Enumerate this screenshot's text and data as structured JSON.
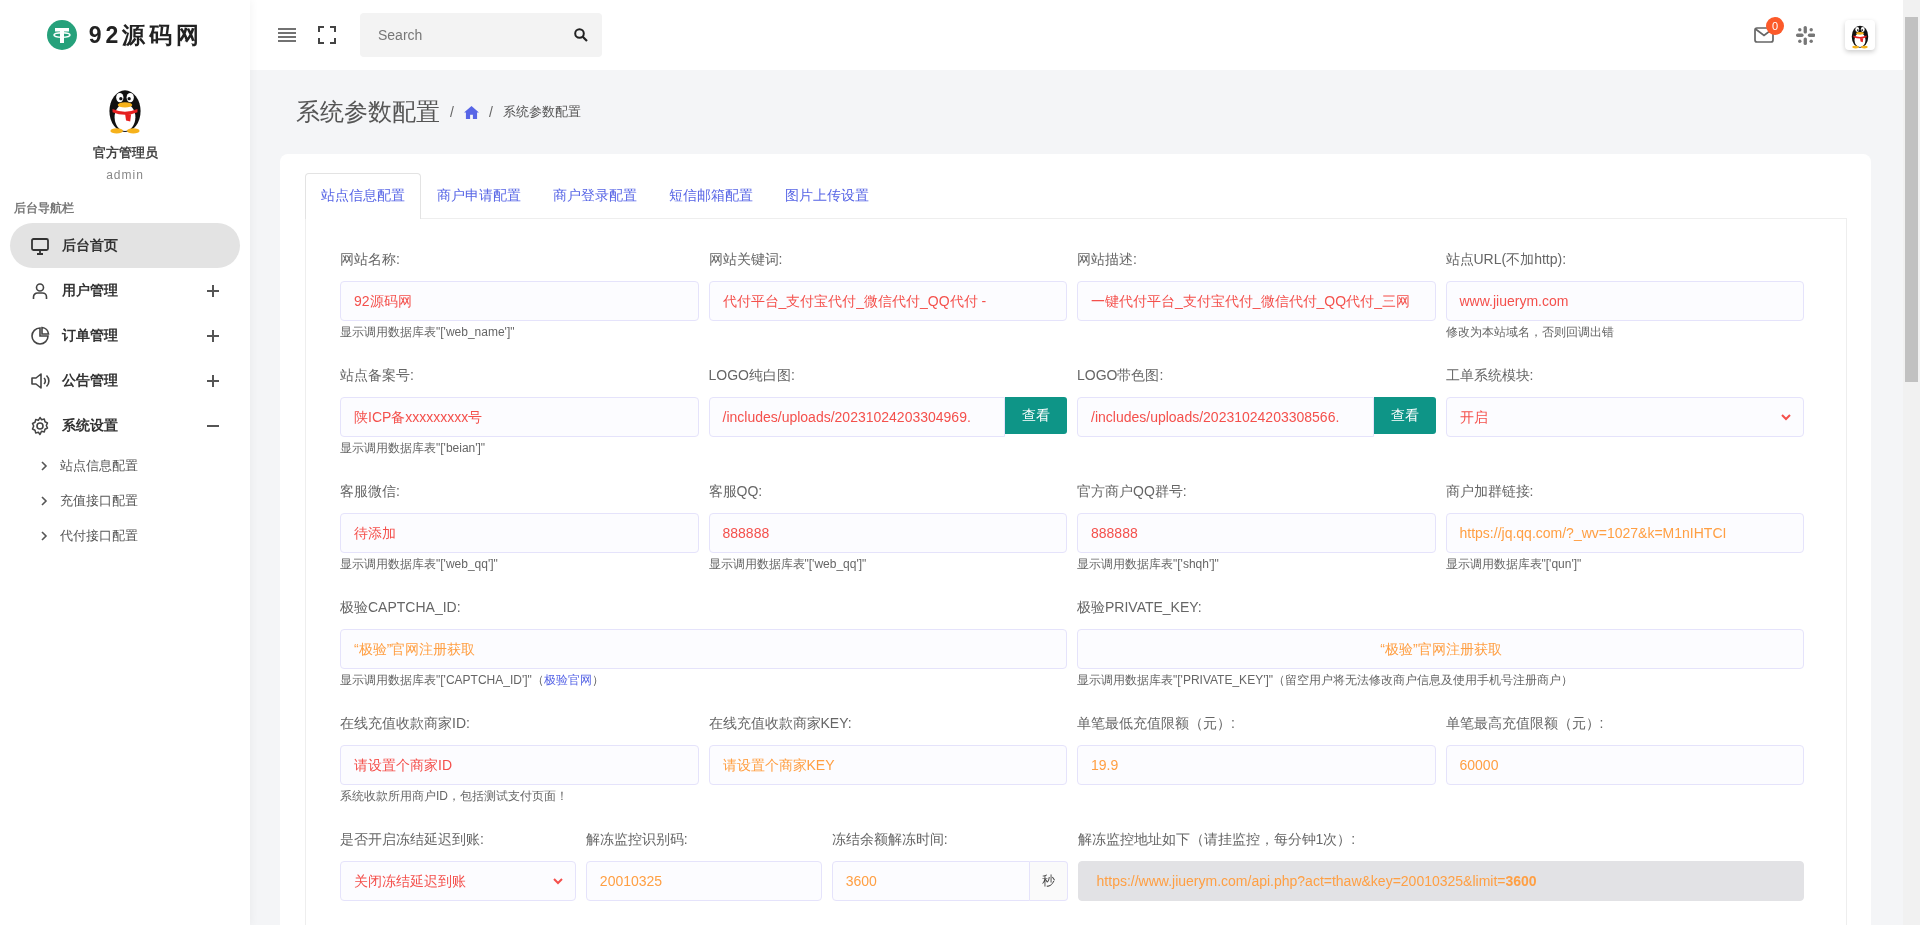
{
  "sidebar": {
    "brand": "92源码网",
    "user_name": "官方管理员",
    "user_role": "admin",
    "section_title": "后台导航栏",
    "nav": [
      {
        "label": "后台首页",
        "selected": true
      },
      {
        "label": "用户管理",
        "selected": false,
        "expanded": false
      },
      {
        "label": "订单管理",
        "selected": false,
        "expanded": false
      },
      {
        "label": "公告管理",
        "selected": false,
        "expanded": false
      },
      {
        "label": "系统设置",
        "selected": false,
        "expanded": true,
        "children": [
          {
            "label": "站点信息配置"
          },
          {
            "label": "充值接口配置"
          },
          {
            "label": "代付接口配置"
          }
        ]
      }
    ]
  },
  "header": {
    "search": {
      "placeholder": "Search"
    },
    "mail_badge": "0"
  },
  "page": {
    "title": "系统参数配置",
    "breadcrumb": [
      {
        "kind": "separator",
        "text": "/"
      },
      {
        "kind": "home"
      },
      {
        "kind": "separator",
        "text": "/"
      },
      {
        "kind": "current",
        "text": "系统参数配置"
      }
    ]
  },
  "tabs": [
    {
      "label": "站点信息配置",
      "selected": true
    },
    {
      "label": "商户申请配置",
      "selected": false
    },
    {
      "label": "商户登录配置",
      "selected": false
    },
    {
      "label": "短信邮箱配置",
      "selected": false
    },
    {
      "label": "图片上传设置",
      "selected": false
    }
  ],
  "form": {
    "rows": [
      {
        "kind": "quarters",
        "fields": [
          {
            "kind": "text",
            "label": "网站名称:",
            "value": "92源码网",
            "color": "#f4504c",
            "hint": "显示调用数据库表\"['web_name']\""
          },
          {
            "kind": "text",
            "label": "网站关键词:",
            "value": "代付平台_支付宝代付_微信代付_QQ代付 -",
            "color": "#f4504c"
          },
          {
            "kind": "text",
            "label": "网站描述:",
            "value": "一键代付平台_支付宝代付_微信代付_QQ代付_三网",
            "color": "#f4504c"
          },
          {
            "kind": "text",
            "label": "站点URL(不加http):",
            "value": "www.jiuerym.com",
            "color": "#f4504c",
            "hint": "修改为本站域名，否则回调出错"
          }
        ]
      },
      {
        "kind": "quarters",
        "fields": [
          {
            "kind": "text",
            "label": "站点备案号:",
            "value": "陕ICP备xxxxxxxxx号",
            "color": "#f4504c",
            "hint": "显示调用数据库表\"['beian']\""
          },
          {
            "kind": "button",
            "label": "LOGO纯白图:",
            "value": "/includes/uploads/20231024203304969.",
            "color": "#f4504c",
            "button": "查看"
          },
          {
            "kind": "button",
            "label": "LOGO带色图:",
            "value": "/includes/uploads/20231024203308566.",
            "color": "#f4504c",
            "button": "查看"
          },
          {
            "kind": "select",
            "label": "工单系统模块:",
            "value": "开启",
            "color": "#f4504c"
          }
        ]
      },
      {
        "kind": "quarters",
        "fields": [
          {
            "kind": "text",
            "label": "客服微信:",
            "value": "待添加",
            "color": "#f4504c",
            "hint": "显示调用数据库表\"['web_qq']\""
          },
          {
            "kind": "text",
            "label": "客服QQ:",
            "value": "888888",
            "color": "#f4504c",
            "hint": "显示调用数据库表\"['web_qq']\""
          },
          {
            "kind": "text",
            "label": "官方商户QQ群号:",
            "value": "888888",
            "color": "#f4504c",
            "hint": "显示调用数据库表\"['shqh']\""
          },
          {
            "kind": "text",
            "label": "商户加群链接:",
            "value": "https://jq.qq.com/?_wv=1027&k=M1nIHTCI",
            "color": "#ff9f43",
            "hint": "显示调用数据库表\"['qun']\""
          }
        ]
      },
      {
        "kind": "halves",
        "fields": [
          {
            "kind": "text",
            "label": "极验CAPTCHA_ID:",
            "value": "“极验”官网注册获取",
            "color": "#ff9f43",
            "hint": "显示调用数据库表\"['CAPTCHA_ID']\"（",
            "hint_link": "极验官网",
            "hint_tail": "）"
          },
          {
            "kind": "centered",
            "label": "极验PRIVATE_KEY:",
            "value": "“极验”官网注册获取",
            "color": "#ff9f43",
            "hint": "显示调用数据库表\"['PRIVATE_KEY']\"（留空用户将无法修改商户信息及使用手机号注册商户）"
          }
        ]
      },
      {
        "kind": "quarters",
        "fields": [
          {
            "kind": "text",
            "label": "在线充值收款商家ID:",
            "value": "请设置个商家ID",
            "color": "#f4504c",
            "hint": "系统收款所用商户ID，包括测试支付页面！"
          },
          {
            "kind": "text",
            "label": "在线充值收款商家KEY:",
            "value": "请设置个商家KEY",
            "color": "#ff9f43"
          },
          {
            "kind": "text",
            "label": "单笔最低充值限额（元）:",
            "value": "19.9",
            "color": "#ff9f43"
          },
          {
            "kind": "text",
            "label": "单笔最高充值限额（元）:",
            "value": "60000",
            "color": "#ff9f43"
          }
        ]
      },
      {
        "kind": "thirds-wide",
        "fields": [
          {
            "kind": "select",
            "label": "是否开启冻结延迟到账:",
            "value": "关闭冻结延迟到账",
            "color": "#f4504c"
          },
          {
            "kind": "text",
            "label": "解冻监控识别码:",
            "value": "20010325",
            "color": "#ff9f43"
          },
          {
            "kind": "addon",
            "label": "冻结余额解冻时间:",
            "value": "3600",
            "color": "#ff9f43",
            "addon": "秒"
          },
          {
            "kind": "readonly",
            "label": "解冻监控地址如下（请挂监控，每分钟1次）:",
            "value": "https://www.jiuerym.com/api.php?act=thaw&key=20010325&limit=**3600**",
            "color": "#ff9f43"
          }
        ]
      }
    ]
  }
}
